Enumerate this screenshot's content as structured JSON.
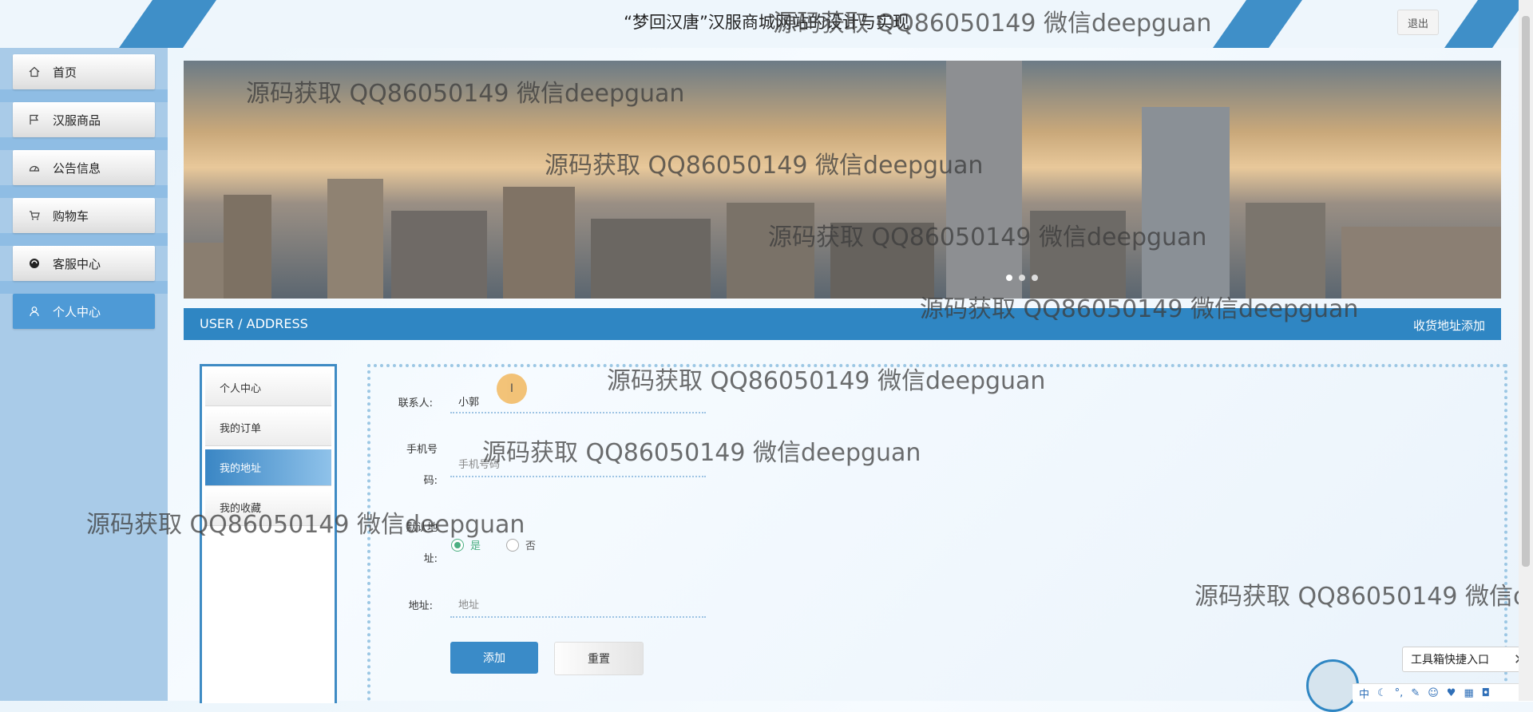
{
  "header": {
    "title": "“梦回汉唐”汉服商城网站的设计与实现",
    "logout_label": "退出"
  },
  "sidebar": {
    "items": [
      {
        "label": "首页",
        "icon": "home-icon"
      },
      {
        "label": "汉服商品",
        "icon": "flag-icon"
      },
      {
        "label": "公告信息",
        "icon": "dashboard-icon"
      },
      {
        "label": "购物车",
        "icon": "cart-icon"
      },
      {
        "label": "客服中心",
        "icon": "service-icon"
      },
      {
        "label": "个人中心",
        "icon": "user-icon",
        "active": true
      }
    ]
  },
  "section": {
    "breadcrumb": "USER / ADDRESS",
    "action": "收货地址添加"
  },
  "subnav": {
    "items": [
      {
        "label": "个人中心"
      },
      {
        "label": "我的订单"
      },
      {
        "label": "我的地址",
        "active": true
      },
      {
        "label": "我的收藏"
      }
    ]
  },
  "form": {
    "contact_label": "联系人:",
    "contact_value": "小郭",
    "phone_label_line1": "手机号",
    "phone_label_line2": "码:",
    "phone_placeholder": "手机号码",
    "default_label_line1": "默认地",
    "default_label_line2": "址:",
    "radio_yes": "是",
    "radio_no": "否",
    "address_label": "地址:",
    "address_placeholder": "地址",
    "submit_label": "添加",
    "reset_label": "重置"
  },
  "watermark": "源码获取 QQ86050149 微信deepguan",
  "toolbox": {
    "label": "工具箱快捷入口",
    "close": "✕"
  },
  "ime": {
    "label": "中"
  },
  "colors": {
    "primary": "#2f86c3",
    "sidebar_bg": "#a9cbe8",
    "radio_checked": "#4caf82"
  }
}
